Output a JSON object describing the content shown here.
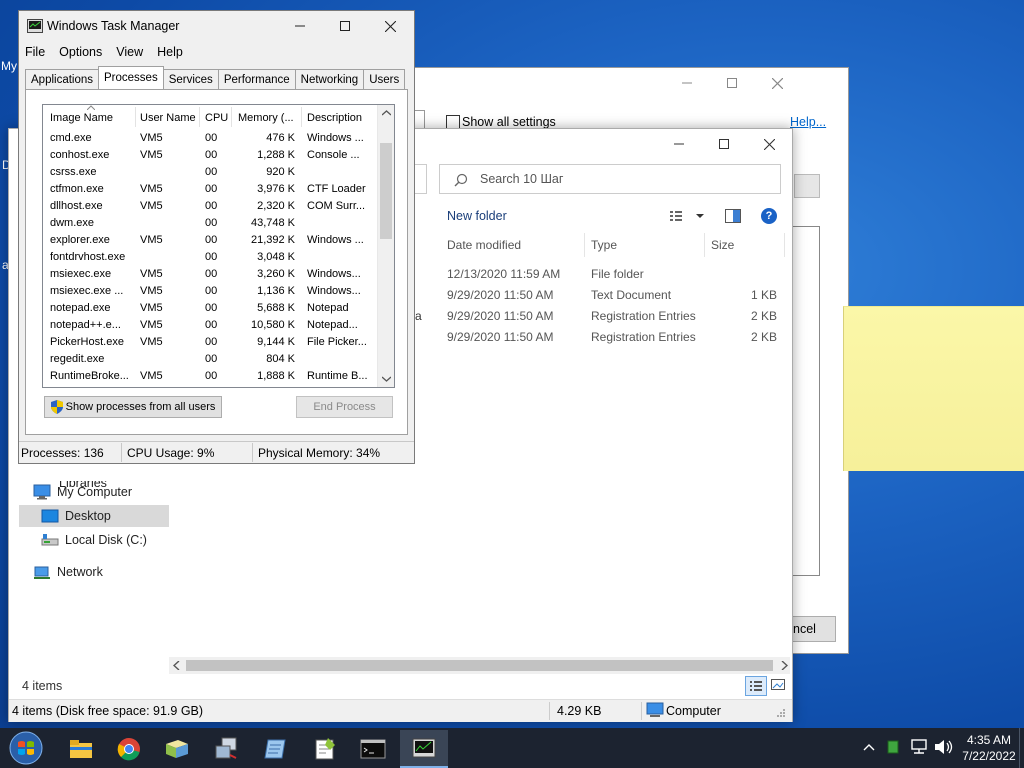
{
  "desktop": {
    "edge_labels": [
      "My",
      "D",
      "a"
    ]
  },
  "settings_window": {
    "show_all_settings": "Show all settings",
    "help_link": "Help...",
    "cancel_fragment": "ncel"
  },
  "explorer": {
    "search_placeholder": "Search 10 Шаг",
    "new_folder": "New folder",
    "columns": [
      "Date modified",
      "Type",
      "Size"
    ],
    "rows": [
      {
        "date": "12/13/2020 11:59 AM",
        "type": "File folder",
        "size": ""
      },
      {
        "date": "9/29/2020 11:50 AM",
        "type": "Text Document",
        "size": "1 KB"
      },
      {
        "date": "9/29/2020 11:50 AM",
        "type": "Registration Entries",
        "size": "2 KB"
      },
      {
        "date": "9/29/2020 11:50 AM",
        "type": "Registration Entries",
        "size": "2 KB"
      }
    ],
    "name_fragment": "a",
    "nav": {
      "partial_top": "Libraries",
      "my_computer": "My Computer",
      "desktop": "Desktop",
      "local_disk": "Local Disk (C:)",
      "network": "Network"
    },
    "item_count": "4 items",
    "status_left": "4 items (Disk free space: 91.9 GB)",
    "status_size": "4.29 KB",
    "status_location": "Computer"
  },
  "task_manager": {
    "title": "Windows Task Manager",
    "menu": [
      "File",
      "Options",
      "View",
      "Help"
    ],
    "tabs": [
      "Applications",
      "Processes",
      "Services",
      "Performance",
      "Networking",
      "Users"
    ],
    "active_tab": "Processes",
    "columns": [
      "Image Name",
      "User Name",
      "CPU",
      "Memory (...",
      "Description"
    ],
    "processes": [
      {
        "name": "cmd.exe",
        "user": "VM5",
        "cpu": "00",
        "mem": "476 K",
        "desc": "Windows ..."
      },
      {
        "name": "conhost.exe",
        "user": "VM5",
        "cpu": "00",
        "mem": "1,288 K",
        "desc": "Console ..."
      },
      {
        "name": "csrss.exe",
        "user": "",
        "cpu": "00",
        "mem": "920 K",
        "desc": ""
      },
      {
        "name": "ctfmon.exe",
        "user": "VM5",
        "cpu": "00",
        "mem": "3,976 K",
        "desc": "CTF Loader"
      },
      {
        "name": "dllhost.exe",
        "user": "VM5",
        "cpu": "00",
        "mem": "2,320 K",
        "desc": "COM Surr..."
      },
      {
        "name": "dwm.exe",
        "user": "",
        "cpu": "00",
        "mem": "43,748 K",
        "desc": ""
      },
      {
        "name": "explorer.exe",
        "user": "VM5",
        "cpu": "00",
        "mem": "21,392 K",
        "desc": "Windows ..."
      },
      {
        "name": "fontdrvhost.exe",
        "user": "",
        "cpu": "00",
        "mem": "3,048 K",
        "desc": ""
      },
      {
        "name": "msiexec.exe",
        "user": "VM5",
        "cpu": "00",
        "mem": "3,260 K",
        "desc": "Windows..."
      },
      {
        "name": "msiexec.exe ...",
        "user": "VM5",
        "cpu": "00",
        "mem": "1,136 K",
        "desc": "Windows..."
      },
      {
        "name": "notepad.exe",
        "user": "VM5",
        "cpu": "00",
        "mem": "5,688 K",
        "desc": "Notepad"
      },
      {
        "name": "notepad++.e...",
        "user": "VM5",
        "cpu": "00",
        "mem": "10,580 K",
        "desc": "Notepad..."
      },
      {
        "name": "PickerHost.exe",
        "user": "VM5",
        "cpu": "00",
        "mem": "9,144 K",
        "desc": "File Picker..."
      },
      {
        "name": "regedit.exe",
        "user": "",
        "cpu": "00",
        "mem": "804 K",
        "desc": ""
      },
      {
        "name": "RuntimeBroke...",
        "user": "VM5",
        "cpu": "00",
        "mem": "1,888 K",
        "desc": "Runtime B..."
      }
    ],
    "show_all_button": "Show processes from all users",
    "end_process_button": "End Process",
    "status": {
      "processes": "Processes: 136",
      "cpu": "CPU Usage: 9%",
      "memory": "Physical Memory: 34%"
    }
  },
  "taskbar": {
    "icons": [
      "start-orb-icon",
      "file-explorer-icon",
      "chrome-icon",
      "folder-sync-icon",
      "network-tool-icon",
      "notes-icon",
      "notepadpp-icon",
      "cmd-icon",
      "task-manager-icon"
    ],
    "time": "4:35 AM",
    "date": "7/22/2022"
  },
  "colors": {
    "taskbar": "#1c2330",
    "accent": "#0078d7",
    "sticky": "#f8f3a0"
  }
}
